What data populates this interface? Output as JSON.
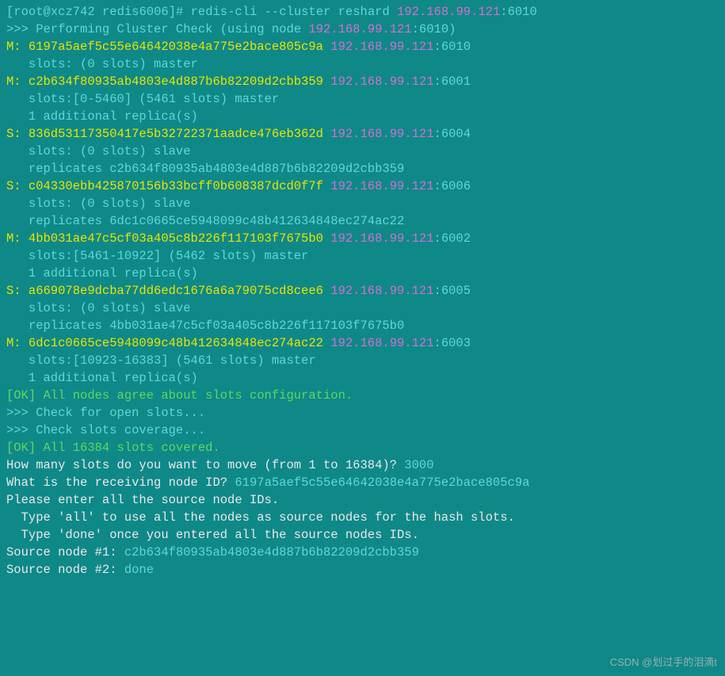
{
  "prompt": {
    "user": "root",
    "host": "xcz742",
    "dir": "redis6006",
    "command": "redis-cli --cluster reshard ",
    "target_ip": "192.168.99.121",
    "target_port": ":6010"
  },
  "check_header": {
    "prefix": ">>> Performing Cluster Check (using node ",
    "ip": "192.168.99.121",
    "suffix": ":6010)"
  },
  "nodes": [
    {
      "role": "M",
      "id": "6197a5aef5c55e64642038e4a775e2bace805c9a",
      "ip": "192.168.99.121",
      "port": ":6010",
      "slots": "   slots: (0 slots) master",
      "extra": null,
      "replicates": null
    },
    {
      "role": "M",
      "id": "c2b634f80935ab4803e4d887b6b82209d2cbb359",
      "ip": "192.168.99.121",
      "port": ":6001",
      "slots": "   slots:[0-5460] (5461 slots) master",
      "extra": "   1 additional replica(s)",
      "replicates": null
    },
    {
      "role": "S",
      "id": "836d53117350417e5b32722371aadce476eb362d",
      "ip": "192.168.99.121",
      "port": ":6004",
      "slots": "   slots: (0 slots) slave",
      "extra": null,
      "replicates": "   replicates c2b634f80935ab4803e4d887b6b82209d2cbb359"
    },
    {
      "role": "S",
      "id": "c04330ebb425870156b33bcff0b608387dcd0f7f",
      "ip": "192.168.99.121",
      "port": ":6006",
      "slots": "   slots: (0 slots) slave",
      "extra": null,
      "replicates": "   replicates 6dc1c0665ce5948099c48b412634848ec274ac22"
    },
    {
      "role": "M",
      "id": "4bb031ae47c5cf03a405c8b226f117103f7675b0",
      "ip": "192.168.99.121",
      "port": ":6002",
      "slots": "   slots:[5461-10922] (5462 slots) master",
      "extra": "   1 additional replica(s)",
      "replicates": null
    },
    {
      "role": "S",
      "id": "a669078e9dcba77dd6edc1676a6a79075cd8cee6",
      "ip": "192.168.99.121",
      "port": ":6005",
      "slots": "   slots: (0 slots) slave",
      "extra": null,
      "replicates": "   replicates 4bb031ae47c5cf03a405c8b226f117103f7675b0"
    },
    {
      "role": "M",
      "id": "6dc1c0665ce5948099c48b412634848ec274ac22",
      "ip": "192.168.99.121",
      "port": ":6003",
      "slots": "   slots:[10923-16383] (5461 slots) master",
      "extra": "   1 additional replica(s)",
      "replicates": null
    }
  ],
  "status": {
    "ok1": "[OK] All nodes agree about slots configuration.",
    "check_open": ">>> Check for open slots...",
    "check_cov": ">>> Check slots coverage...",
    "ok2": "[OK] All 16384 slots covered."
  },
  "qa": {
    "q_slots": "How many slots do you want to move (from 1 to 16384)? ",
    "a_slots": "3000",
    "q_recv": "What is the receiving node ID? ",
    "a_recv": "6197a5aef5c55e64642038e4a775e2bace805c9a",
    "src_intro": "Please enter all the source node IDs.",
    "src_help1": "  Type 'all' to use all the nodes as source nodes for the hash slots.",
    "src_help2": "  Type 'done' once you entered all the source nodes IDs.",
    "src1_label": "Source node #1: ",
    "src1_val": "c2b634f80935ab4803e4d887b6b82209d2cbb359",
    "src2_label": "Source node #2: ",
    "src2_val": "done"
  },
  "watermark": "CSDN @划过手的泪滴t"
}
